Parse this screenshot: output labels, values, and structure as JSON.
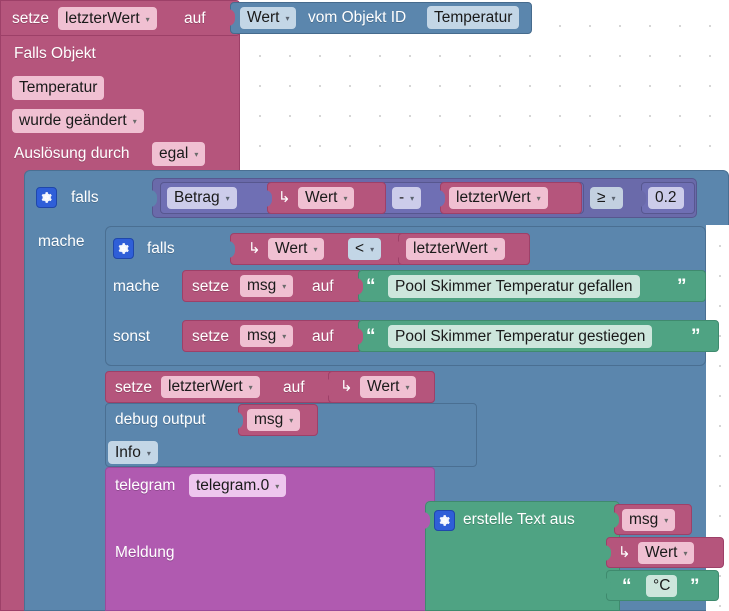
{
  "program": {
    "trigger": {
      "set_label": "setze",
      "set_var": "letzterWert",
      "auf_label": "auf",
      "getter": {
        "value_field": "Wert",
        "of_object_label": "vom Objekt ID",
        "object_id": "Temperatur"
      },
      "falls_objekt_label": "Falls Objekt",
      "object_name": "Temperatur",
      "condition": "wurde geändert",
      "trigger_by_label": "Auslösung durch",
      "trigger_by_value": "egal"
    },
    "outer_if": {
      "if_label": "falls",
      "do_label": "mache",
      "abs_function": "Betrag",
      "left_operand": "Wert",
      "operator_minus": "-",
      "right_operand": "letzterWert",
      "compare_operator": "≥",
      "threshold": "0.2"
    },
    "inner_if": {
      "if_label": "falls",
      "do_label": "mache",
      "else_label": "sonst",
      "left_operand": "Wert",
      "compare_operator": "<",
      "right_operand": "letzterWert",
      "then_set_label": "setze",
      "then_set_var": "msg",
      "then_auf_label": "auf",
      "then_text": "Pool Skimmer Temperatur gefallen",
      "else_set_label": "setze",
      "else_set_var": "msg",
      "else_auf_label": "auf",
      "else_text": "Pool Skimmer Temperatur gestiegen"
    },
    "after": {
      "set_label": "setze",
      "set_var": "letzterWert",
      "auf_label": "auf",
      "set_value": "Wert",
      "debug_label": "debug output",
      "debug_value": "msg",
      "debug_level": "Info",
      "telegram_label": "telegram",
      "telegram_instance": "telegram.0",
      "message_label": "Meldung",
      "create_text_label": "erstelle Text aus",
      "text_part_1": "msg",
      "text_part_2": "Wert",
      "text_part_3": "°C"
    }
  },
  "glyphs": {
    "arrow": "↳",
    "quote_open": "“",
    "quote_close": "”",
    "caret": "▾"
  },
  "colors": {
    "pink": "#b5557c",
    "blue": "#5b86ad",
    "green": "#4fa383",
    "purple": "#b05ab0",
    "math": "#6a6aaa",
    "gear": "#2f5fd8"
  }
}
